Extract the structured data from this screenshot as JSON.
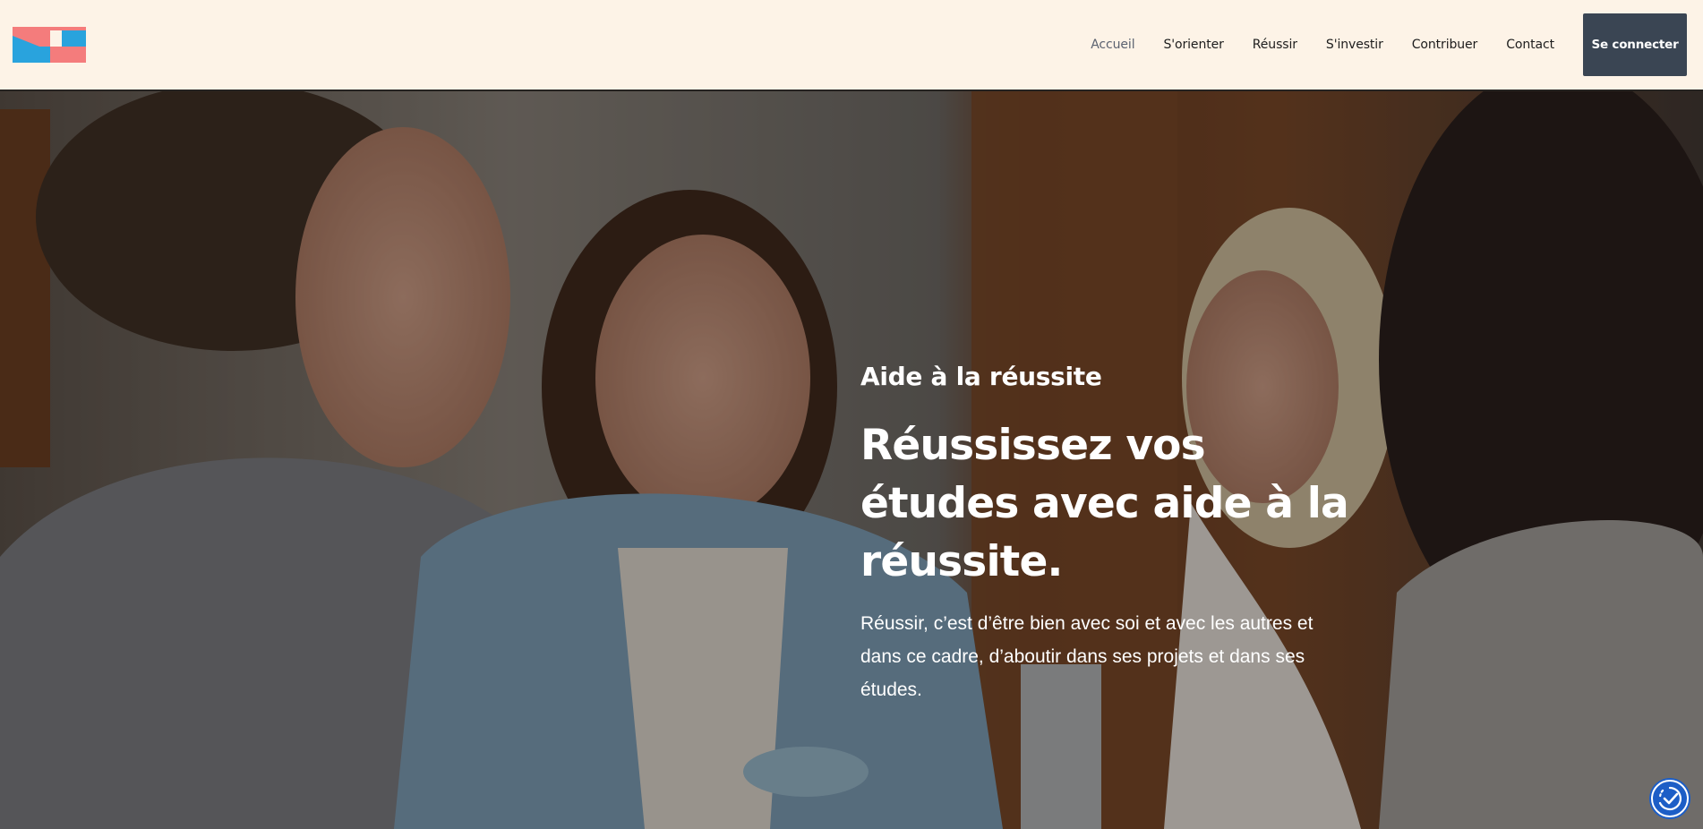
{
  "brand": {
    "logo_name": "site-logo",
    "colors": {
      "coral": "#f47c7c",
      "blue": "#29a3dd"
    }
  },
  "nav": {
    "items": [
      {
        "label": "Accueil",
        "active": true
      },
      {
        "label": "S'orienter"
      },
      {
        "label": "Réussir"
      },
      {
        "label": "S'investir"
      },
      {
        "label": "Contribuer"
      },
      {
        "label": "Contact"
      }
    ],
    "login_label": "Se connecter"
  },
  "hero": {
    "eyebrow": "Aide à la réussite",
    "title": "Réussissez vos études avec aide à la réussite.",
    "description": "Réussir, c’est d’être bien avec soi et avec les autres et dans ce cadre, d’aboutir dans ses projets et dans ses études."
  },
  "accessibility": {
    "icon": "accessibility-check-icon",
    "color": "#1d5ec6"
  }
}
